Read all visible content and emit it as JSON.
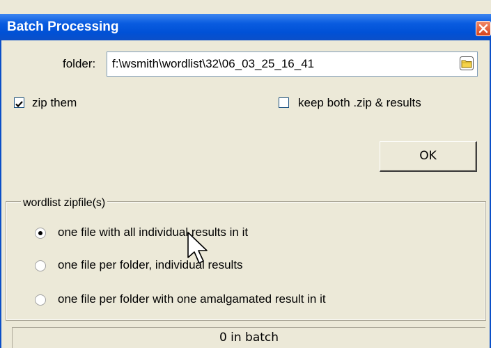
{
  "window": {
    "title": "Batch Processing"
  },
  "folder": {
    "label": "folder:",
    "value": "f:\\wsmith\\wordlist\\32\\06_03_25_16_41"
  },
  "options": {
    "zip_them_label": "zip them",
    "zip_them_checked": true,
    "keep_both_label": "keep both .zip & results",
    "keep_both_checked": false
  },
  "ok_button": {
    "label": "OK"
  },
  "zipfile_group": {
    "legend": "wordlist zipfile(s)",
    "radios": [
      {
        "label": "one file with all individual results in it",
        "selected": true
      },
      {
        "label": "one file per folder, individual results",
        "selected": false
      },
      {
        "label": "one file per folder with one amalgamated result in it",
        "selected": false
      }
    ]
  },
  "status": {
    "text": "0 in batch"
  },
  "colors": {
    "titlebar": "#0a5ce0",
    "window_bg": "#ece9d8",
    "close_button": "#d9421a"
  },
  "icons": [
    "close-icon",
    "folder-icon",
    "checkmark-icon",
    "mouse-pointer-icon"
  ]
}
